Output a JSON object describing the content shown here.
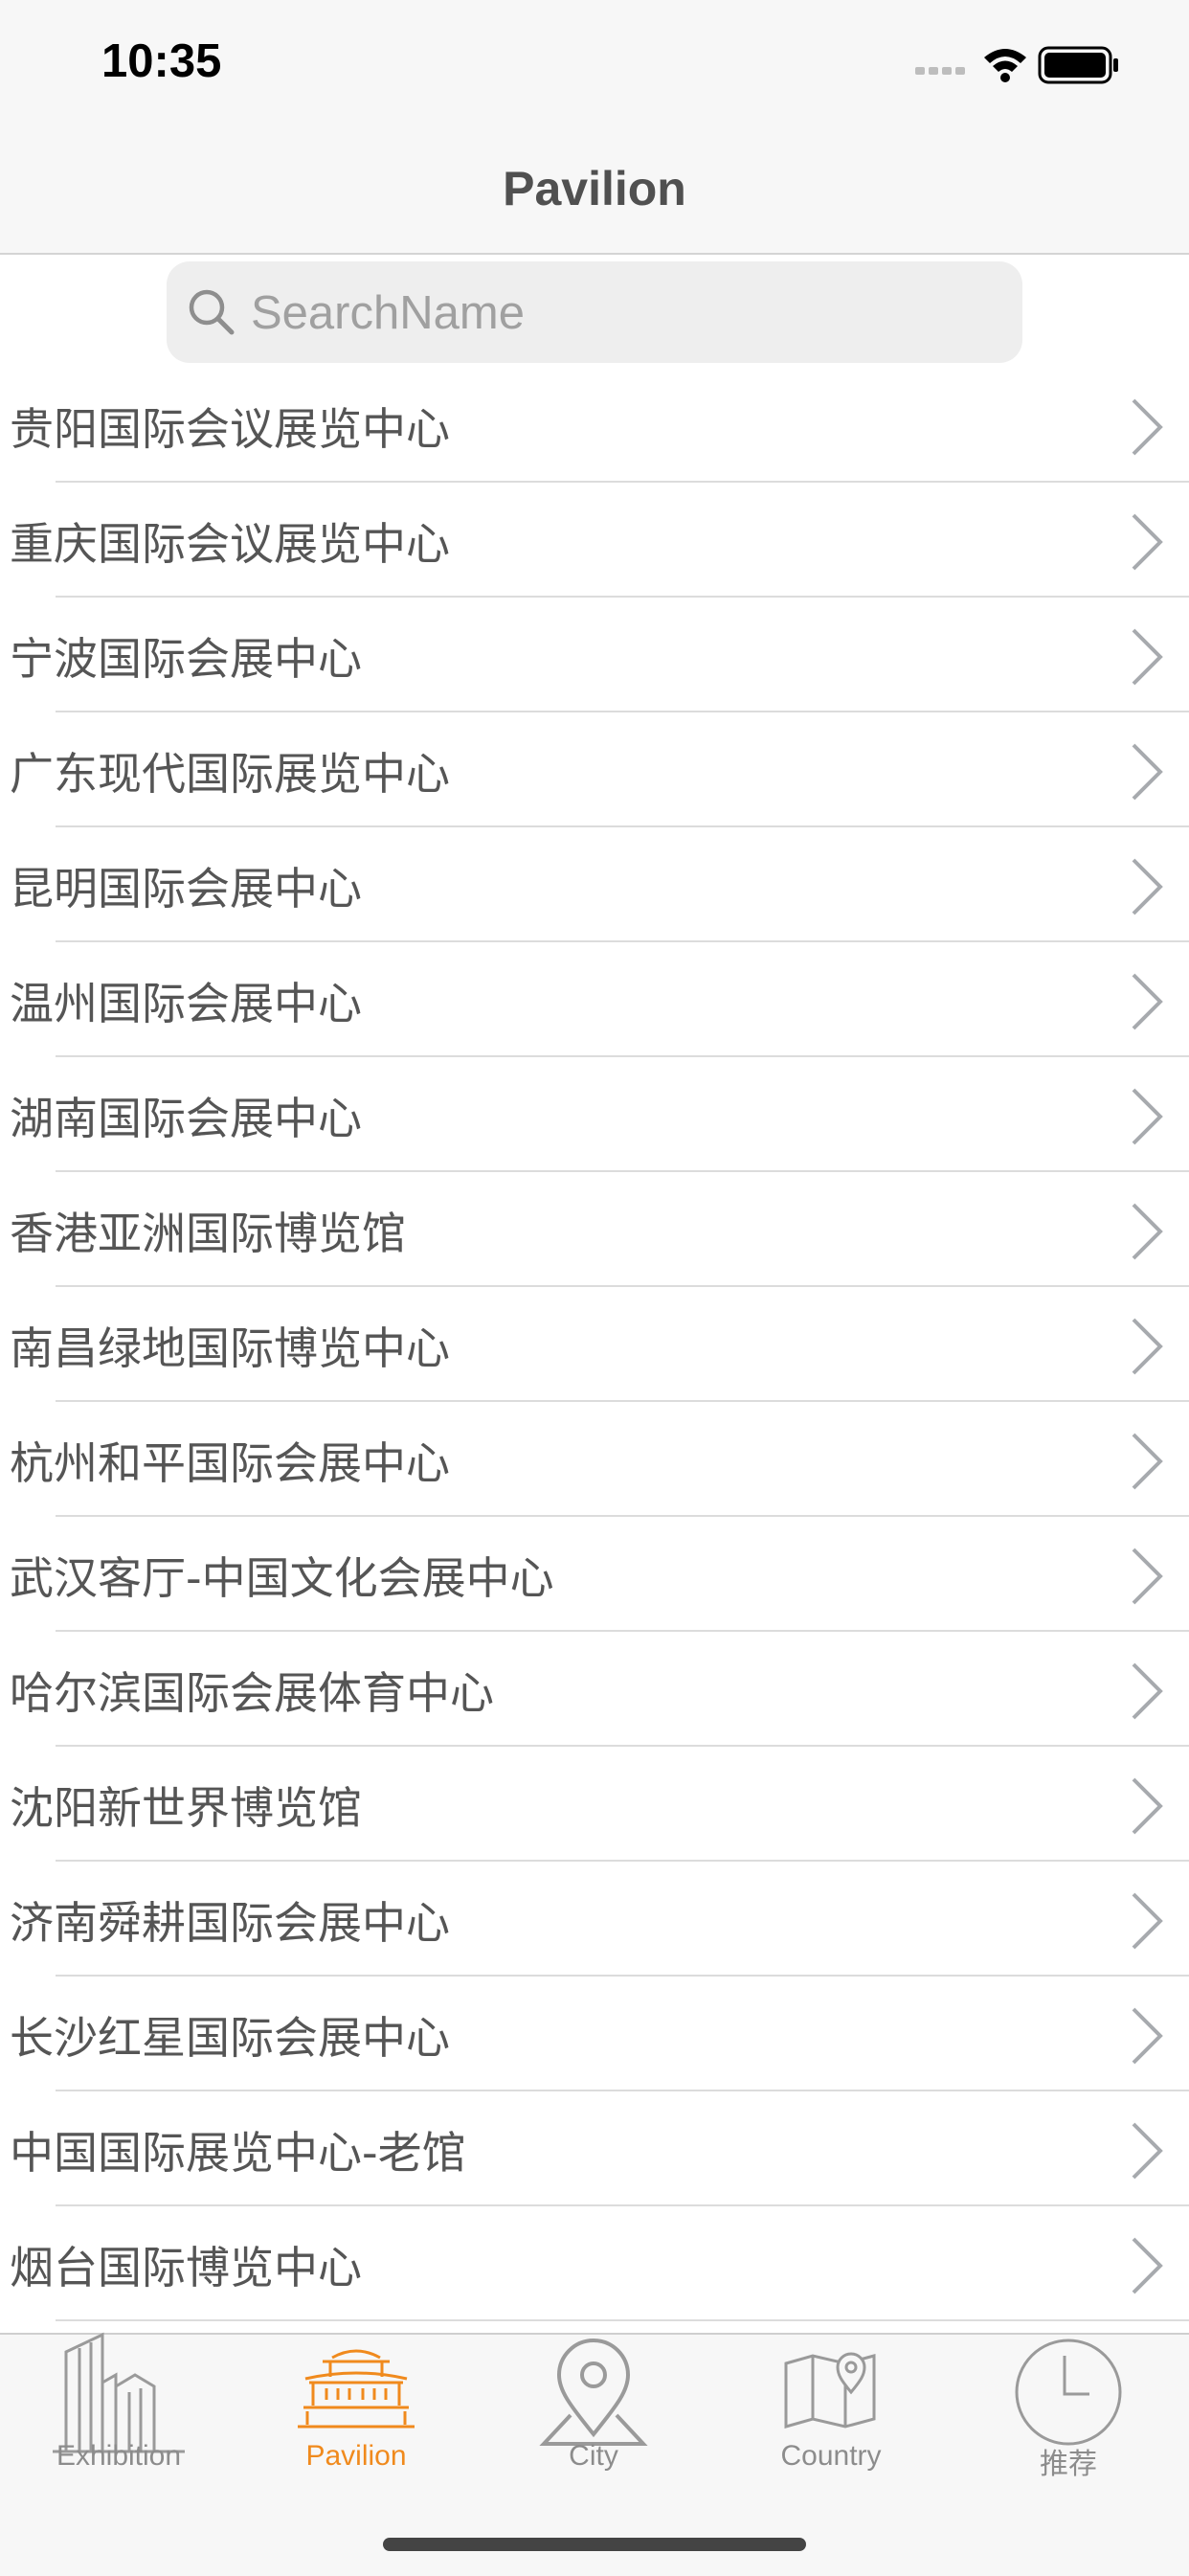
{
  "status": {
    "time": "10:35"
  },
  "nav": {
    "title": "Pavilion"
  },
  "search": {
    "placeholder": "SearchName",
    "value": ""
  },
  "pavilions": [
    "贵阳国际会议展览中心",
    "重庆国际会议展览中心",
    "宁波国际会展中心",
    "广东现代国际展览中心",
    "昆明国际会展中心",
    "温州国际会展中心",
    "湖南国际会展中心",
    "香港亚洲国际博览馆",
    "南昌绿地国际博览中心",
    "杭州和平国际会展中心",
    "武汉客厅-中国文化会展中心",
    "哈尔滨国际会展体育中心",
    "沈阳新世界博览馆",
    "济南舜耕国际会展中心",
    "长沙红星国际会展中心",
    "中国国际展览中心-老馆",
    "烟台国际博览中心"
  ],
  "tabs": [
    {
      "label": "Exhibition",
      "icon": "buildings-icon",
      "active": false
    },
    {
      "label": "Pavilion",
      "icon": "pavilion-icon",
      "active": true
    },
    {
      "label": "City",
      "icon": "location-pin-icon",
      "active": false
    },
    {
      "label": "Country",
      "icon": "map-icon",
      "active": false
    },
    {
      "label": "推荐",
      "icon": "clock-icon",
      "active": false
    }
  ],
  "colors": {
    "accent": "#f08a1d",
    "inactive": "#8c8c8c",
    "bar_bg": "#f7f7f7"
  }
}
